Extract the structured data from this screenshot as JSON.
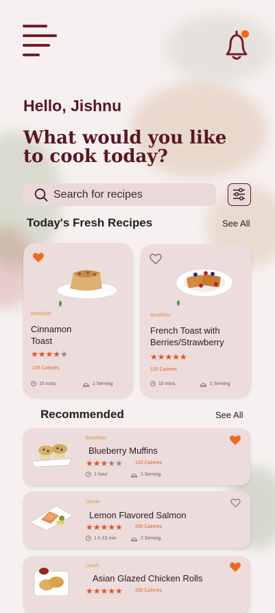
{
  "header": {
    "menu_icon": "hamburger-menu-icon",
    "bell_icon": "notification-bell-icon",
    "notification_dot_color": "#f06a1a"
  },
  "greeting": "Hello, Jishnu",
  "headline": "What would you like to cook today?",
  "search": {
    "placeholder": "Search for recipes"
  },
  "fresh": {
    "title": "Today's Fresh Recipes",
    "see_all": "See All",
    "items": [
      {
        "category": "Breakfast",
        "name": "Cinnamon Toast",
        "rating": 4,
        "calories": "135 Calories",
        "time": "15 mins",
        "serving": "1 Serving",
        "favorite": true
      },
      {
        "category": "Breakfast",
        "name": "French Toast with Berries/Strawberry",
        "rating": 5,
        "calories": "120 Calories",
        "time": "10 mins",
        "serving": "1 Serving",
        "favorite": false
      }
    ]
  },
  "recommended": {
    "title": "Recommended",
    "see_all": "See All",
    "items": [
      {
        "category": "Breakfast",
        "name": "Blueberry Muffins",
        "rating": 3,
        "calories": "120 Calories",
        "time": "1 hour",
        "serving": "1 Serving",
        "favorite": true
      },
      {
        "category": "Dinner",
        "name": "Lemon Flavored Salmon",
        "rating": 5,
        "calories": "280 Calories",
        "time": "1 h 15 min",
        "serving": "2 Serving",
        "favorite": false
      },
      {
        "category": "Lunch",
        "name": "Asian Glazed Chicken Rolls",
        "rating": 5,
        "calories": "280 Calories",
        "favorite": true
      }
    ]
  },
  "colors": {
    "brand": "#5a1620",
    "accent": "#e1521d",
    "card": "#ecdcdb",
    "category": "#e0902b"
  }
}
